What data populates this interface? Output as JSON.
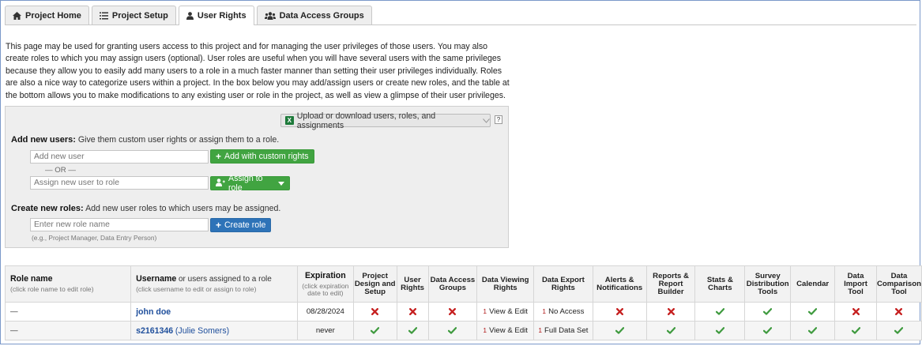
{
  "tabs": [
    {
      "label": "Project Home",
      "icon": "home-icon",
      "active": false
    },
    {
      "label": "Project Setup",
      "icon": "list-icon",
      "active": false
    },
    {
      "label": "User Rights",
      "icon": "user-icon",
      "active": true
    },
    {
      "label": "Data Access Groups",
      "icon": "users-icon",
      "active": false
    }
  ],
  "intro_text": "This page may be used for granting users access to this project and for managing the user privileges of those users. You may also create roles to which you may assign users (optional). User roles are useful when you will have several users with the same privileges because they allow you to easily add many users to a role in a much faster manner than setting their user privileges individually. Roles are also a nice way to categorize users within a project. In the box below you may add/assign users or create new roles, and the table at the bottom allows you to make modifications to any existing user or role in the project, as well as view a glimpse of their user privileges.",
  "panel": {
    "upload_label": "Upload or download users, roles, and assignments",
    "help_label": "?",
    "add_users_title": "Add new users:",
    "add_users_desc": "Give them custom user rights or assign them to a role.",
    "new_user_placeholder": "Add new user",
    "add_custom_label": "Add with custom rights",
    "or_label": "— OR —",
    "assign_user_placeholder": "Assign new user to role",
    "assign_role_label": "Assign to role",
    "create_roles_title": "Create new roles:",
    "create_roles_desc": "Add new user roles to which users may be assigned.",
    "role_name_placeholder": "Enter new role name",
    "create_role_label": "Create role",
    "role_hint": "(e.g., Project Manager, Data Entry Person)"
  },
  "table": {
    "role_header": "Role name",
    "role_sub": "(click role name to edit role)",
    "username_header": "Username",
    "username_header_rest": "or users assigned to a role",
    "username_sub": "(click username to edit or assign to role)",
    "expiration_header": "Expiration",
    "expiration_sub": "(click expiration date to edit)",
    "columns": [
      "Project Design and Setup",
      "User Rights",
      "Data Access Groups",
      "Data Viewing Rights",
      "Data Export Rights",
      "Alerts & Notifications",
      "Reports & Report Builder",
      "Stats & Charts",
      "Survey Distribution Tools",
      "Calendar",
      "Data Import Tool",
      "Data Comparison Tool"
    ],
    "rows": [
      {
        "role": "—",
        "username": "john doe",
        "fullname": "",
        "expiration": "08/28/2024",
        "design": "no",
        "user_rights": "no",
        "dag": "no",
        "viewing_num": "1",
        "viewing": "View & Edit",
        "export_num": "1",
        "export": "No Access",
        "alerts": "no",
        "reports": "no",
        "stats": "yes",
        "survey": "yes",
        "calendar": "yes",
        "import": "no",
        "comparison": "no"
      },
      {
        "role": "—",
        "username": "s2161346",
        "fullname": "(Julie Somers)",
        "expiration": "never",
        "design": "yes",
        "user_rights": "yes",
        "dag": "yes",
        "viewing_num": "1",
        "viewing": "View & Edit",
        "export_num": "1",
        "export": "Full Data Set",
        "alerts": "yes",
        "reports": "yes",
        "stats": "yes",
        "survey": "yes",
        "calendar": "yes",
        "import": "yes",
        "comparison": "yes"
      }
    ]
  },
  "colors": {
    "green_button": "#41a441",
    "blue_button": "#2e73b8",
    "check": "#3e9a3e",
    "cross": "#c62020",
    "link": "#1f4f9c"
  }
}
